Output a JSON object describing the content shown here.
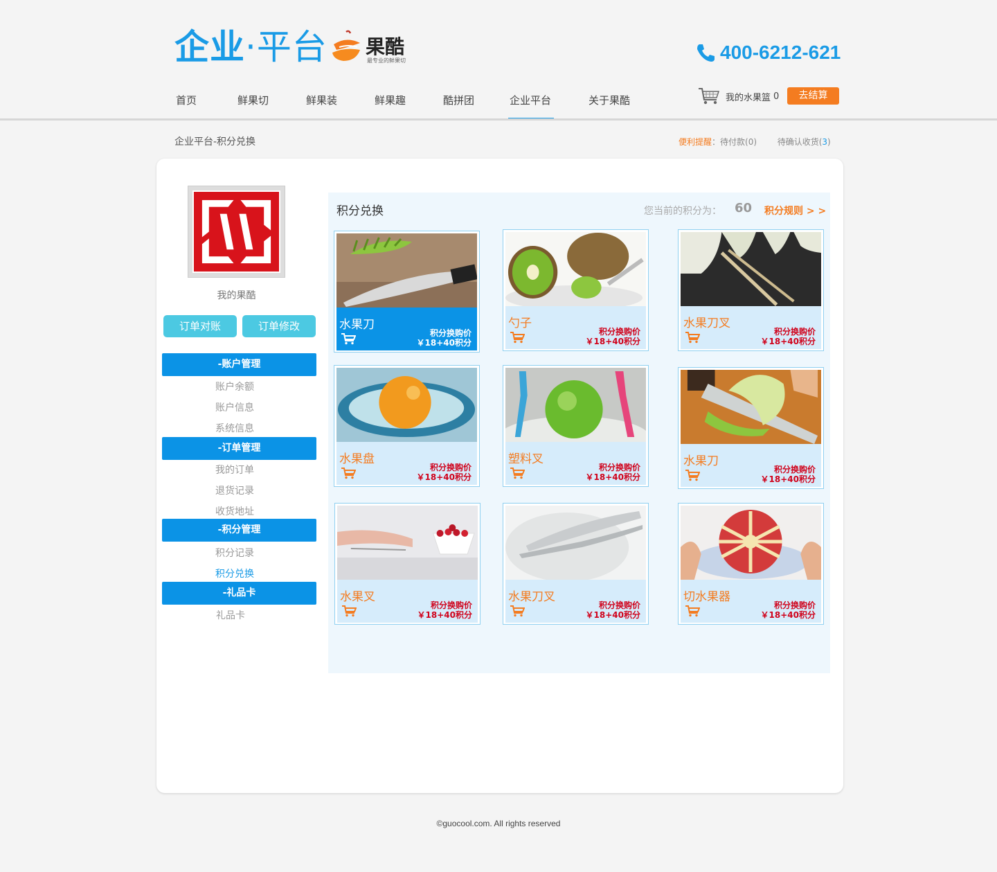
{
  "header": {
    "logo_text_1": "企业",
    "logo_dot": "·",
    "logo_text_2": "平台",
    "brand_name": "果酷",
    "brand_tagline": "最专业的鲜果切",
    "phone": "400-6212-621"
  },
  "nav": {
    "items": [
      {
        "label": "首页"
      },
      {
        "label": "鲜果切"
      },
      {
        "label": "鲜果装"
      },
      {
        "label": "鲜果趣"
      },
      {
        "label": "酷拼团"
      },
      {
        "label": "企业平台",
        "active": true
      },
      {
        "label": "关于果酷"
      }
    ]
  },
  "cart": {
    "label": "我的水果篮",
    "count": "0",
    "checkout_label": "去结算"
  },
  "breadcrumb": "企业平台-积分兑换",
  "reminder": {
    "prefix": "便利提醒",
    "colon": "：",
    "pending_payment": "待付款(0)",
    "pending_receipt_label": "待确认收货(",
    "pending_receipt_count": "3",
    "pending_receipt_close": ")"
  },
  "sidebar": {
    "my_link": "我的果酷",
    "btn_reconcile": "订单对账",
    "btn_modify": "订单修改",
    "groups": [
      {
        "title": "-账户管理",
        "items": [
          "账户余额",
          "账户信息",
          "系统信息"
        ]
      },
      {
        "title": "-订单管理",
        "items": [
          "我的订单",
          "退货记录",
          "收货地址"
        ]
      },
      {
        "title": "-积分管理",
        "items": [
          "积分记录",
          "积分兑换"
        ]
      },
      {
        "title": "-礼品卡",
        "items": [
          "礼品卡"
        ]
      }
    ]
  },
  "exchange": {
    "title": "积分兑换",
    "points_label": "您当前的积分为：",
    "points_value": "60",
    "rules_link": "积分规则 > >",
    "products": [
      {
        "name": "水果刀",
        "price_label": "积分换购价",
        "price": "￥18+40积分"
      },
      {
        "name": "勺子",
        "price_label": "积分换购价",
        "price": "￥18+40积分"
      },
      {
        "name": "水果刀叉",
        "price_label": "积分换购价",
        "price": "￥18+40积分"
      },
      {
        "name": "水果盘",
        "price_label": "积分换购价",
        "price": "￥18+40积分"
      },
      {
        "name": "塑料叉",
        "price_label": "积分换购价",
        "price": "￥18+40积分"
      },
      {
        "name": "水果刀",
        "price_label": "积分换购价",
        "price": "￥18+40积分"
      },
      {
        "name": "水果叉",
        "price_label": "积分换购价",
        "price": "￥18+40积分"
      },
      {
        "name": "水果刀叉",
        "price_label": "积分换购价",
        "price": "￥18+40积分"
      },
      {
        "name": "切水果器",
        "price_label": "积分换购价",
        "price": "￥18+40积分"
      }
    ]
  },
  "footer": "©guocool.com. All rights reserved",
  "colors": {
    "brand_blue": "#1a9be6",
    "accent_orange": "#f47c20",
    "price_red": "#d0021b",
    "menu_blue": "#0b93e6",
    "button_cyan": "#4cc9e2"
  }
}
